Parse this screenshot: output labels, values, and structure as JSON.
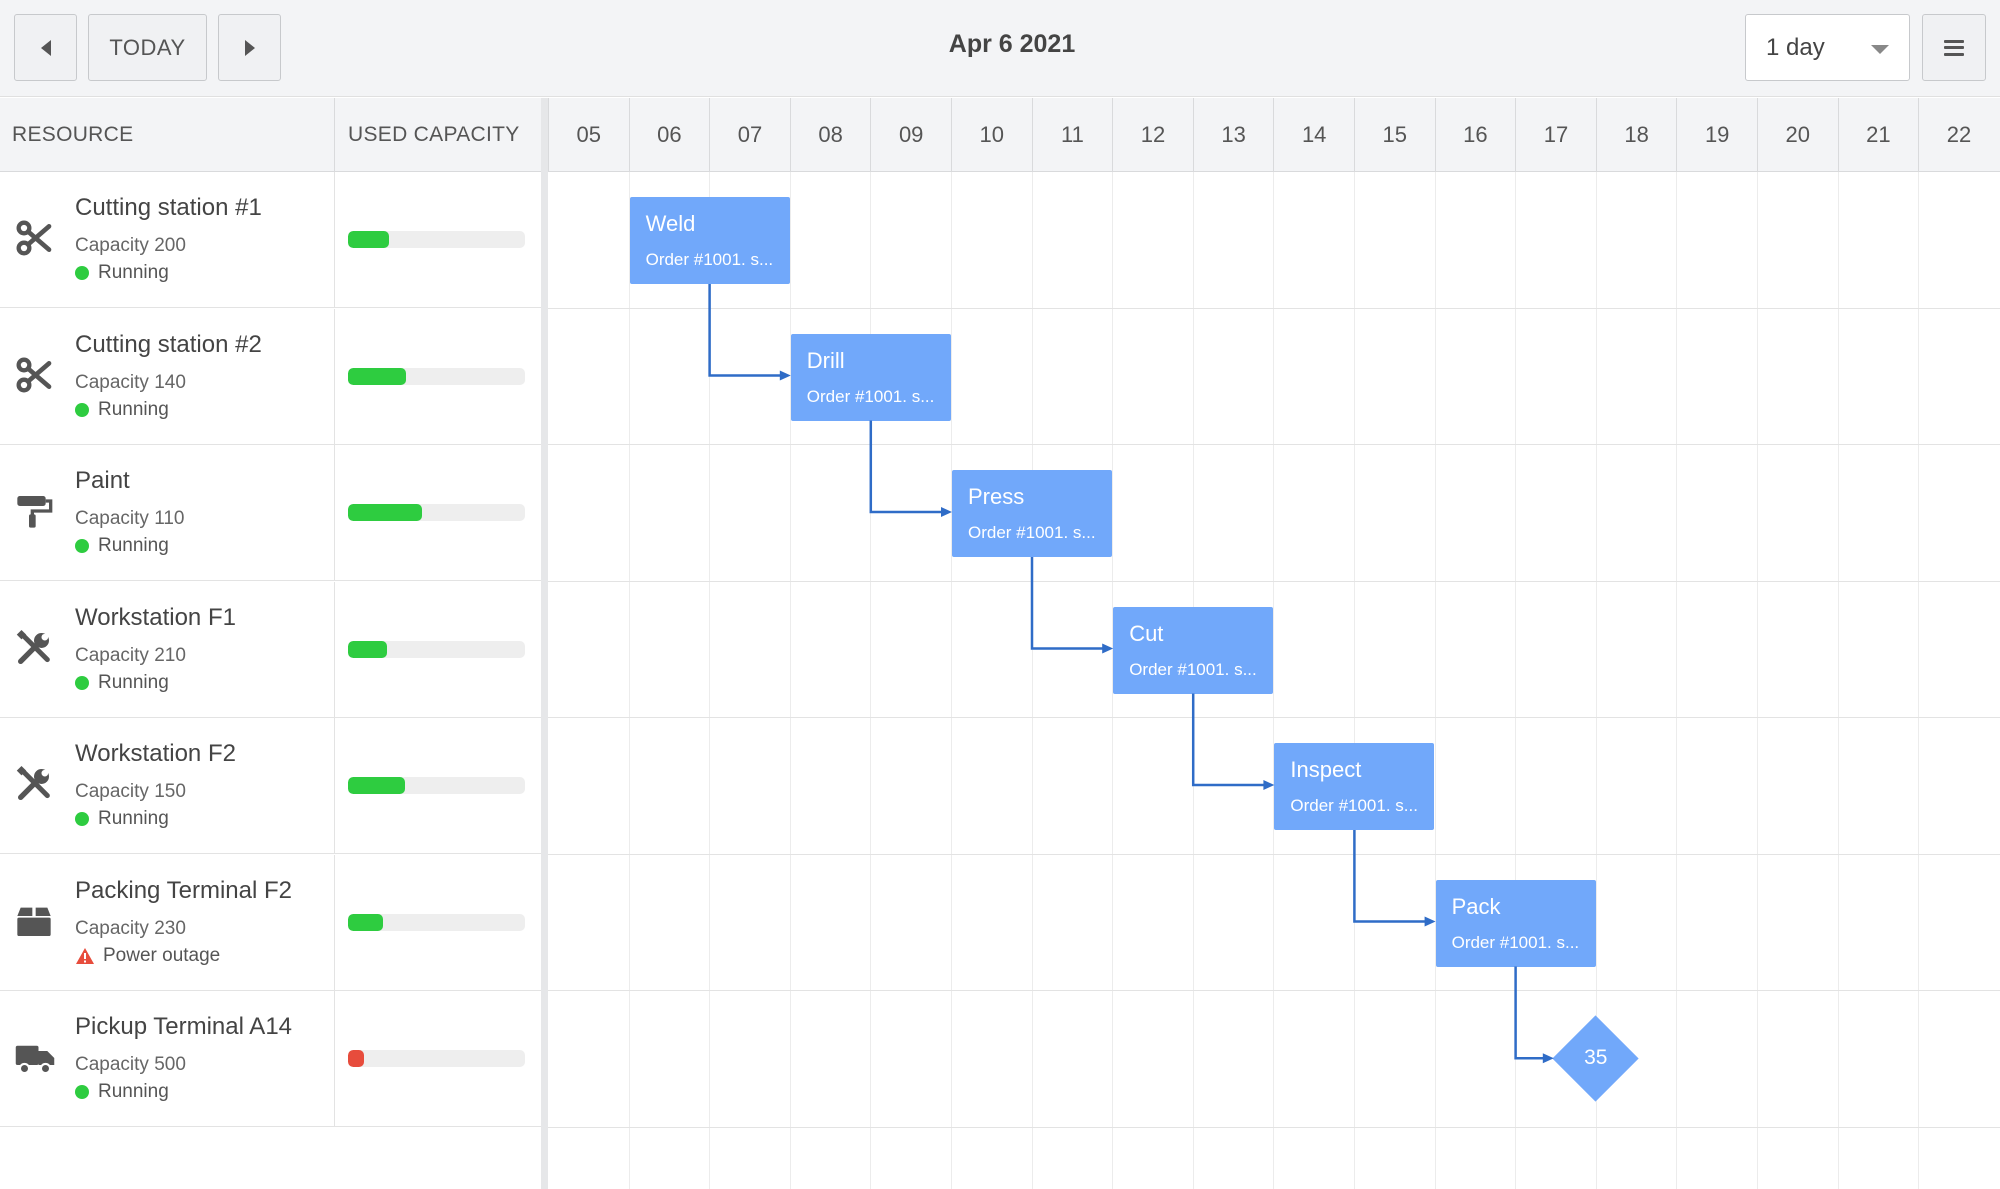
{
  "toolbar": {
    "today_label": "TODAY",
    "date_title": "Apr 6 2021",
    "zoom_value": "1 day"
  },
  "columns": {
    "resource": "RESOURCE",
    "used_capacity": "USED CAPACITY"
  },
  "timeline": {
    "ticks": [
      "05",
      "06",
      "07",
      "08",
      "09",
      "10",
      "11",
      "12",
      "13",
      "14",
      "15",
      "16",
      "17",
      "18",
      "19",
      "20",
      "21",
      "22"
    ]
  },
  "resources": [
    {
      "name": "Cutting station #1",
      "capacity": "Capacity 200",
      "status": "Running",
      "status_type": "ok",
      "icon": "scissors-icon",
      "used_fraction": 0.23
    },
    {
      "name": "Cutting station #2",
      "capacity": "Capacity 140",
      "status": "Running",
      "status_type": "ok",
      "icon": "scissors-icon",
      "used_fraction": 0.33
    },
    {
      "name": "Paint",
      "capacity": "Capacity 110",
      "status": "Running",
      "status_type": "ok",
      "icon": "paint-roller-icon",
      "used_fraction": 0.42
    },
    {
      "name": "Workstation F1",
      "capacity": "Capacity 210",
      "status": "Running",
      "status_type": "ok",
      "icon": "tools-icon",
      "used_fraction": 0.22
    },
    {
      "name": "Workstation F2",
      "capacity": "Capacity 150",
      "status": "Running",
      "status_type": "ok",
      "icon": "tools-icon",
      "used_fraction": 0.32
    },
    {
      "name": "Packing Terminal F2",
      "capacity": "Capacity 230",
      "status": "Power outage",
      "status_type": "warning",
      "icon": "box-icon",
      "used_fraction": 0.2
    },
    {
      "name": "Pickup Terminal A14",
      "capacity": "Capacity 500",
      "status": "Running",
      "status_type": "ok",
      "icon": "truck-icon",
      "used_fraction": 0.09
    }
  ],
  "tasks": [
    {
      "name": "Weld",
      "order": "Order #1001. s...",
      "row": 0,
      "start_tick": "06"
    },
    {
      "name": "Drill",
      "order": "Order #1001. s...",
      "row": 1,
      "start_tick": "08"
    },
    {
      "name": "Press",
      "order": "Order #1001. s...",
      "row": 2,
      "start_tick": "10"
    },
    {
      "name": "Cut",
      "order": "Order #1001. s...",
      "row": 3,
      "start_tick": "12"
    },
    {
      "name": "Inspect",
      "order": "Order #1001. s...",
      "row": 4,
      "start_tick": "14"
    },
    {
      "name": "Pack",
      "order": "Order #1001. s...",
      "row": 5,
      "start_tick": "16"
    }
  ],
  "milestone": {
    "label": "35",
    "row": 6,
    "tick": "18"
  },
  "colors": {
    "task": "#71a8fa",
    "dependency_line": "#2f6cc7",
    "status_ok": "#2ecc40",
    "status_warning": "#e74c3c",
    "bar_ok": "#2ecc40",
    "bar_critical": "#e74c3c"
  }
}
